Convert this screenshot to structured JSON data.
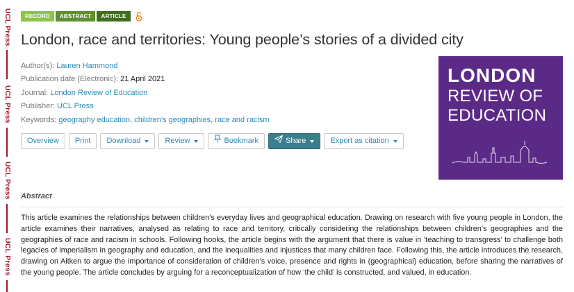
{
  "side_brand": {
    "labels": [
      "UCL Press",
      "UCL Press",
      "UCL Press",
      "UCL Press"
    ],
    "color": "#a3152b"
  },
  "badges": {
    "record": "RECORD",
    "abstract": "ABSTRACT",
    "article": "ARTICLE",
    "open_access_icon": "open-access-lock-icon"
  },
  "title": "London, race and territories: Young people’s stories of a divided city",
  "meta": {
    "authors_label": "Author(s):",
    "authors_value": "Lauren Hammond",
    "pubdate_label": "Publication date (Electronic):",
    "pubdate_value": "21 April 2021",
    "journal_label": "Journal:",
    "journal_value": "London Review of Education",
    "publisher_label": "Publisher:",
    "publisher_value": "UCL Press",
    "keywords_label": "Keywords:",
    "keywords": [
      "geography education",
      "children’s geographies",
      "race and racism"
    ]
  },
  "toolbar": {
    "overview": "Overview",
    "print": "Print",
    "download": "Download",
    "review": "Review",
    "bookmark": "Bookmark",
    "share": "Share",
    "export": "Export as citation"
  },
  "cover": {
    "line1": "LONDON",
    "line2": "REVIEW OF",
    "line3": "EDUCATION",
    "bg": "#5b2a86"
  },
  "abstract": {
    "heading": "Abstract",
    "text": "This article examines the relationships between children’s everyday lives and geographical education. Drawing on research with five young people in London, the article examines their narratives, analysed as relating to race and territory, critically considering the relationships between children’s geographies and the geographies of race and racism in schools. Following hooks, the article begins with the argument that there is value in ‘teaching to transgress’ to challenge both legacies of imperialism in geography and education, and the inequalities and injustices that many children face. Following this, the article introduces the research, drawing on Aitken to argue the importance of consideration of children’s voice, presence and rights in (geographical) education, before sharing the narratives of the young people. The article concludes by arguing for a reconceptualization of how ‘the child’ is constructed, and valued, in education."
  },
  "colors": {
    "link": "#2a8ab7",
    "share_button": "#3b7e8c"
  }
}
